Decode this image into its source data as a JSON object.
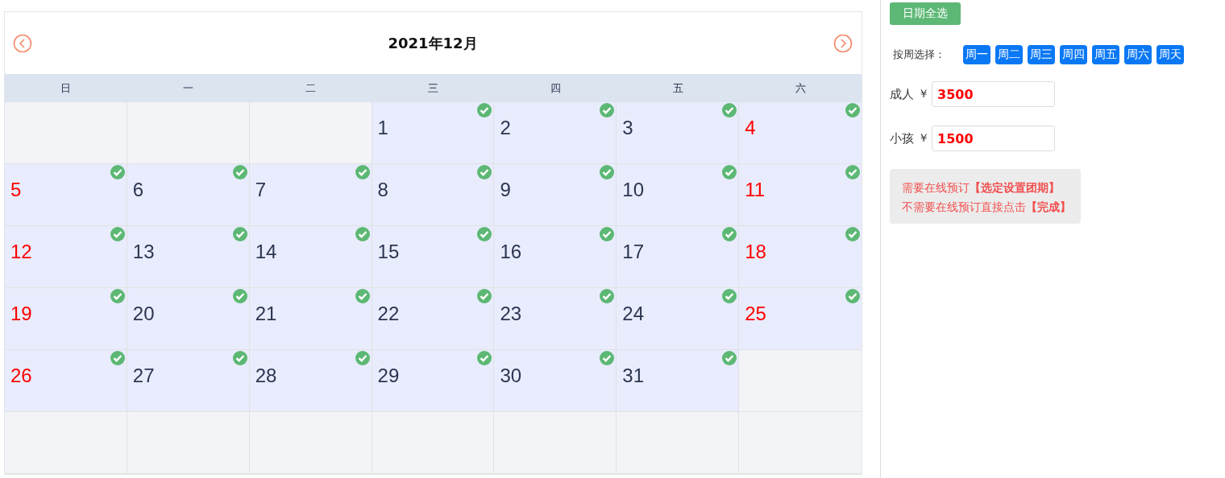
{
  "calendar": {
    "title": "2021年12月",
    "weekdays": [
      "日",
      "一",
      "二",
      "三",
      "四",
      "五",
      "六"
    ],
    "weeks": [
      [
        {
          "kind": "blank"
        },
        {
          "kind": "blank"
        },
        {
          "kind": "blank"
        },
        {
          "kind": "day",
          "day": "1",
          "checked": true,
          "weekend": false
        },
        {
          "kind": "day",
          "day": "2",
          "checked": true,
          "weekend": false
        },
        {
          "kind": "day",
          "day": "3",
          "checked": true,
          "weekend": false
        },
        {
          "kind": "day",
          "day": "4",
          "checked": true,
          "weekend": true
        }
      ],
      [
        {
          "kind": "day",
          "day": "5",
          "checked": true,
          "weekend": true
        },
        {
          "kind": "day",
          "day": "6",
          "checked": true,
          "weekend": false
        },
        {
          "kind": "day",
          "day": "7",
          "checked": true,
          "weekend": false
        },
        {
          "kind": "day",
          "day": "8",
          "checked": true,
          "weekend": false
        },
        {
          "kind": "day",
          "day": "9",
          "checked": true,
          "weekend": false
        },
        {
          "kind": "day",
          "day": "10",
          "checked": true,
          "weekend": false
        },
        {
          "kind": "day",
          "day": "11",
          "checked": true,
          "weekend": true
        }
      ],
      [
        {
          "kind": "day",
          "day": "12",
          "checked": true,
          "weekend": true
        },
        {
          "kind": "day",
          "day": "13",
          "checked": true,
          "weekend": false
        },
        {
          "kind": "day",
          "day": "14",
          "checked": true,
          "weekend": false
        },
        {
          "kind": "day",
          "day": "15",
          "checked": true,
          "weekend": false
        },
        {
          "kind": "day",
          "day": "16",
          "checked": true,
          "weekend": false
        },
        {
          "kind": "day",
          "day": "17",
          "checked": true,
          "weekend": false
        },
        {
          "kind": "day",
          "day": "18",
          "checked": true,
          "weekend": true
        }
      ],
      [
        {
          "kind": "day",
          "day": "19",
          "checked": true,
          "weekend": true
        },
        {
          "kind": "day",
          "day": "20",
          "checked": true,
          "weekend": false
        },
        {
          "kind": "day",
          "day": "21",
          "checked": true,
          "weekend": false
        },
        {
          "kind": "day",
          "day": "22",
          "checked": true,
          "weekend": false
        },
        {
          "kind": "day",
          "day": "23",
          "checked": true,
          "weekend": false
        },
        {
          "kind": "day",
          "day": "24",
          "checked": true,
          "weekend": false
        },
        {
          "kind": "day",
          "day": "25",
          "checked": true,
          "weekend": true
        }
      ],
      [
        {
          "kind": "day",
          "day": "26",
          "checked": true,
          "weekend": true
        },
        {
          "kind": "day",
          "day": "27",
          "checked": true,
          "weekend": false
        },
        {
          "kind": "day",
          "day": "28",
          "checked": true,
          "weekend": false
        },
        {
          "kind": "day",
          "day": "29",
          "checked": true,
          "weekend": false
        },
        {
          "kind": "day",
          "day": "30",
          "checked": true,
          "weekend": false
        },
        {
          "kind": "day",
          "day": "31",
          "checked": true,
          "weekend": false
        },
        {
          "kind": "blank"
        }
      ],
      [
        {
          "kind": "blank"
        },
        {
          "kind": "blank"
        },
        {
          "kind": "blank"
        },
        {
          "kind": "blank"
        },
        {
          "kind": "blank"
        },
        {
          "kind": "blank"
        },
        {
          "kind": "blank"
        }
      ]
    ]
  },
  "select_all_button": "日期全选",
  "week_select": {
    "label": "按周选择：",
    "buttons": [
      "周一",
      "周二",
      "周三",
      "周四",
      "周五",
      "周六",
      "周天"
    ]
  },
  "prices": [
    {
      "label": "成人",
      "currency": "￥",
      "value": "3500"
    },
    {
      "label": "小孩",
      "currency": "￥",
      "value": "1500"
    }
  ],
  "notice": [
    "需要在线预订**【选定设置团期】**",
    "不需要在线预订直接点击**【完成】**"
  ]
}
